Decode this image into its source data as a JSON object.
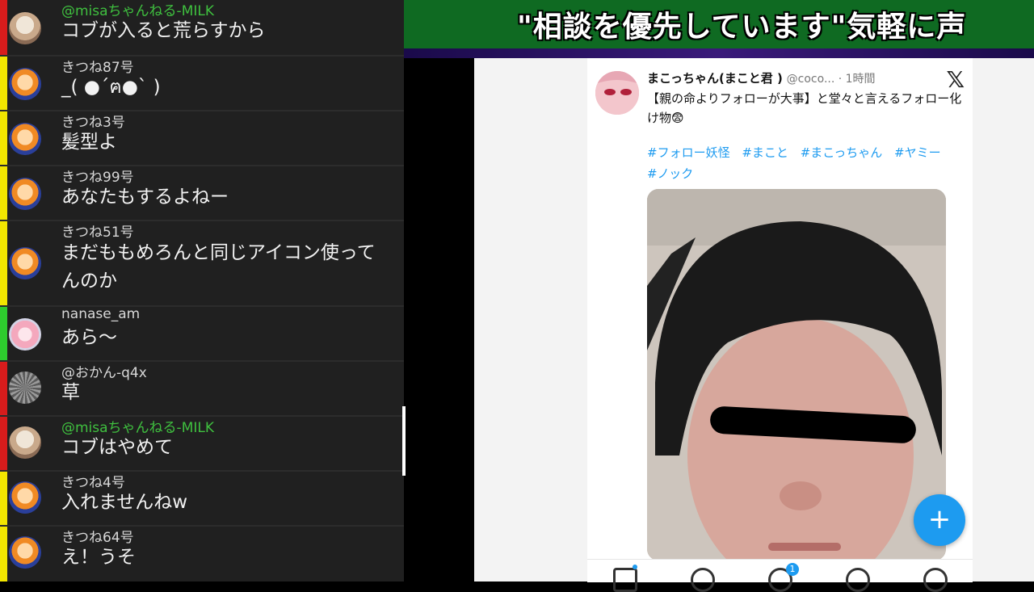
{
  "banner": {
    "ticker": "\"相談を優先しています\"気軽に声"
  },
  "chat": {
    "messages": [
      {
        "name": "@misaちゃんねる-MILK",
        "text": "コブが入ると荒らすから",
        "bar": "#d81c1c",
        "name_color": "#3fc03f",
        "avatar": "misa"
      },
      {
        "name": "きつね87号",
        "text": "_( ●´ฅ●` )",
        "bar": "#f2e600",
        "name_color": "#d8d8d8",
        "avatar": "fox"
      },
      {
        "name": "きつね3号",
        "text": "髪型よ",
        "bar": "#f2e600",
        "name_color": "#d8d8d8",
        "avatar": "fox"
      },
      {
        "name": "きつね99号",
        "text": "あなたもするよねー",
        "bar": "#f2e600",
        "name_color": "#d8d8d8",
        "avatar": "fox"
      },
      {
        "name": "きつね51号",
        "text": "まだももめろんと同じアイコン使ってんのか",
        "bar": "#f2e600",
        "name_color": "#d8d8d8",
        "avatar": "fox"
      },
      {
        "name": "nanase_am",
        "text": "あら～",
        "bar": "#2ecc2e",
        "name_color": "#d8d8d8",
        "avatar": "nanase"
      },
      {
        "name": "@おかん-q4x",
        "text": "草",
        "bar": "#d81c1c",
        "name_color": "#d8d8d8",
        "avatar": "okan"
      },
      {
        "name": "@misaちゃんねる-MILK",
        "text": "コブはやめて",
        "bar": "#d81c1c",
        "name_color": "#3fc03f",
        "avatar": "misa"
      },
      {
        "name": "きつね4号",
        "text": "入れませんねw",
        "bar": "#f2e600",
        "name_color": "#d8d8d8",
        "avatar": "fox"
      },
      {
        "name": "きつね64号",
        "text": "え！うそ",
        "bar": "#f2e600",
        "name_color": "#d8d8d8",
        "avatar": "fox"
      }
    ]
  },
  "tweet": {
    "display_name": "まこっちゃん(まこと君 )",
    "handle": "@coco... · 1時間",
    "body": "【親の命よりフォローが大事】と堂々と言えるフォロー化け物😨",
    "hashtags": [
      "#フォロー妖怪",
      "#まこと",
      "#まこっちゃん",
      "#ヤミー",
      "#ノック"
    ],
    "close_glyph": "𝕏",
    "fab_glyph": "+",
    "notification_count": "1"
  }
}
